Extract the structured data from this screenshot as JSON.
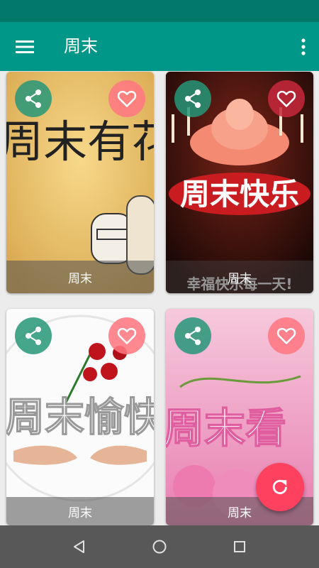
{
  "app_bar": {
    "title": "周末",
    "menu_icon": "menu-icon",
    "more_icon": "more-vert-icon"
  },
  "colors": {
    "status_bar": "#00796b",
    "app_bar": "#009688",
    "fab": "#ff4160",
    "share_button": "#269678",
    "like_button": "#ff7882",
    "nav_bar": "#585858"
  },
  "cards": [
    {
      "caption": "周末",
      "image_text": "周末有花"
    },
    {
      "caption": "周末",
      "image_text": "周末快乐",
      "image_subtext": "幸福快乐每一天!"
    },
    {
      "caption": "周末",
      "image_text": "周末愉快"
    },
    {
      "caption": "周末",
      "image_text": "周末看"
    }
  ],
  "fab": {
    "icon": "refresh-icon"
  },
  "nav": {
    "back_icon": "back-icon",
    "home_icon": "home-icon",
    "recents_icon": "recents-icon"
  }
}
